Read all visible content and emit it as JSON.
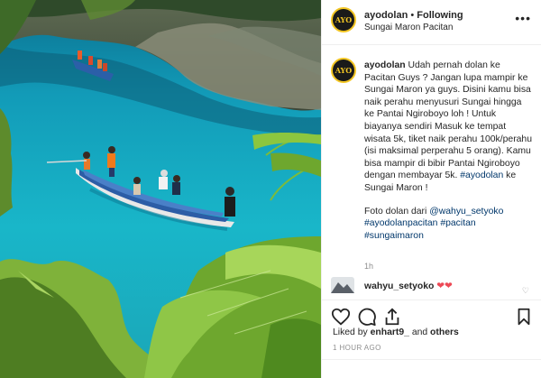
{
  "post": {
    "username": "ayodolan",
    "separator": "•",
    "follow_status": "Following",
    "location": "Sungai Maron Pacitan",
    "more_label": "•••"
  },
  "caption": {
    "username": "ayodolan",
    "body": "Udah pernah dolan ke Pacitan Guys ? Jangan lupa mampir ke Sungai Maron ya guys. Disini kamu bisa naik perahu menyusuri Sungai hingga ke Pantai Ngiroboyo loh ! Untuk biayanya sendiri Masuk ke tempat wisata 5k, tiket naik perahu 100k/perahu (isi maksimal perperahu 5 orang). Kamu bisa mampir di bibir Pantai Ngiroboyo dengan membayar 5k.",
    "hashtag_inline": "#ayodolan",
    "body_end": "ke Sungai Maron !",
    "credit_prefix": "Foto dolan dari",
    "credit_user": "@wahyu_setyoko",
    "hashtags": "#ayodolanpacitan #pacitan #sungaimaron",
    "age": "1h"
  },
  "comment": {
    "username": "wahyu_setyoko",
    "text": "❤❤"
  },
  "likes": {
    "prefix": "Liked by",
    "user": "enhart9_",
    "middle": "and",
    "others": "others"
  },
  "timestamp": "1 HOUR AGO",
  "avatar_mark": "ayo dolan",
  "colors": {
    "accent_link": "#00376b",
    "heart": "#ed4956",
    "brand_ring": "#f3c623"
  }
}
